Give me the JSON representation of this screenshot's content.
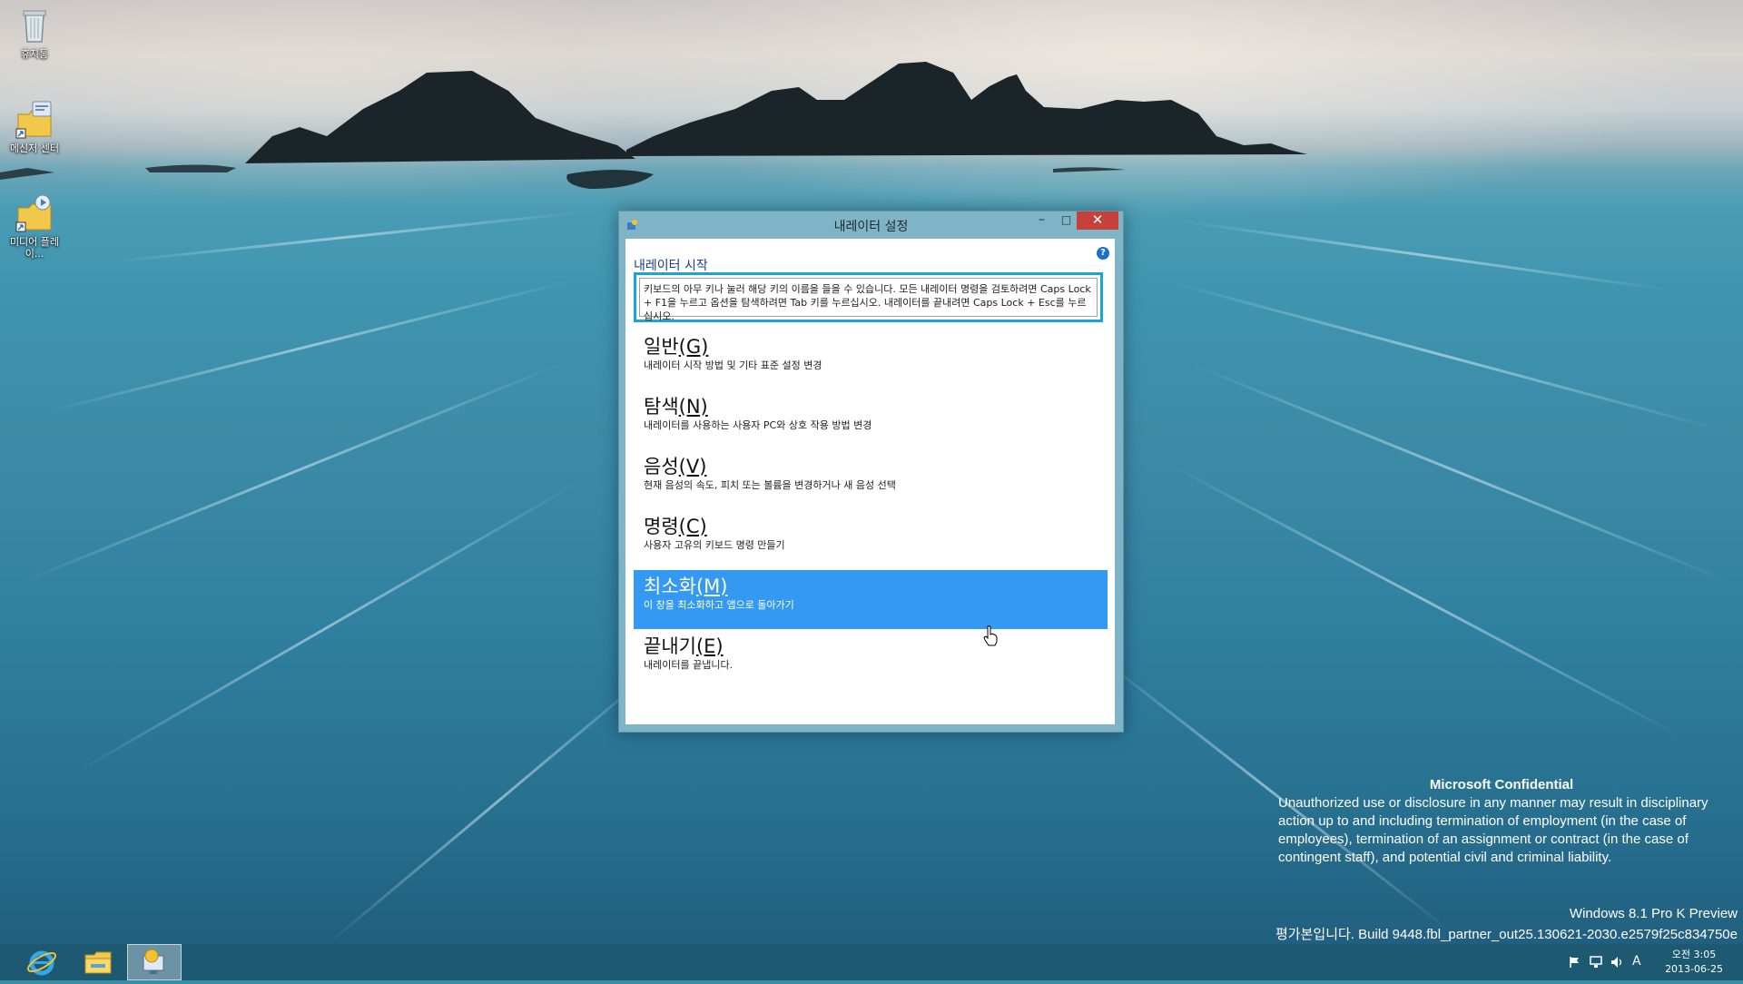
{
  "desktop": {
    "icons": [
      {
        "label": "휴지통"
      },
      {
        "label": "메신저 센터"
      },
      {
        "label": "미디어 플레이..."
      }
    ]
  },
  "window": {
    "title": "내레이터 설정",
    "minimize_glyph": "–",
    "maximize_glyph": "□",
    "close_glyph": "✕",
    "help_glyph": "?",
    "section_heading": "내레이터 시작",
    "info_text": "키보드의 아무 키나 눌러 해당 키의 이름을 들을 수 있습니다. 모든 내레이터 명령을 검토하려면 Caps Lock + F1을 누르고 옵션을 탐색하려면 Tab 키를 누르십시오. 내레이터를 끝내려면 Caps Lock + Esc를 누르십시오.",
    "menu": [
      {
        "title": "일반",
        "key": "(G)",
        "desc": "내레이터 시작 방법 및 기타 표준 설정 변경"
      },
      {
        "title": "탐색",
        "key": "(N)",
        "desc": "내레이터를 사용하는 사용자 PC와 상호 작용 방법 변경"
      },
      {
        "title": "음성",
        "key": "(V)",
        "desc": "현재 음성의 속도, 피치 또는 볼륨을 변경하거나 새 음성 선택"
      },
      {
        "title": "명령",
        "key": "(C)",
        "desc": "사용자 고유의 키보드 명령 만들기"
      },
      {
        "title": "최소화",
        "key": "(M)",
        "desc": "이 창을 최소화하고 앱으로 돌아가기"
      },
      {
        "title": "끝내기",
        "key": "(E)",
        "desc": "내레이터를 끝냅니다."
      }
    ],
    "selected_index": 4
  },
  "watermark": {
    "heading": "Microsoft Confidential",
    "body": "Unauthorized use or disclosure in any manner may result in disciplinary action up to and including termination of employment (in the case of employees), termination of an assignment or contract (in the case of contingent staff), and potential civil and criminal liability.",
    "edition": "Windows 8.1 Pro K Preview",
    "build": "평가본입니다. Build 9448.fbl_partner_out25.130621-2030.e2579f25c834750e"
  },
  "taskbar": {
    "apps": [
      "internet-explorer",
      "file-explorer",
      "narrator"
    ],
    "tray_lang": "A",
    "clock_time": "오전 3:05",
    "clock_date": "2013-06-25"
  },
  "colors": {
    "selection": "#3399f3",
    "focus_border": "#1aa5d6",
    "close_button": "#c7403a",
    "taskbar": "#1d5a72"
  }
}
